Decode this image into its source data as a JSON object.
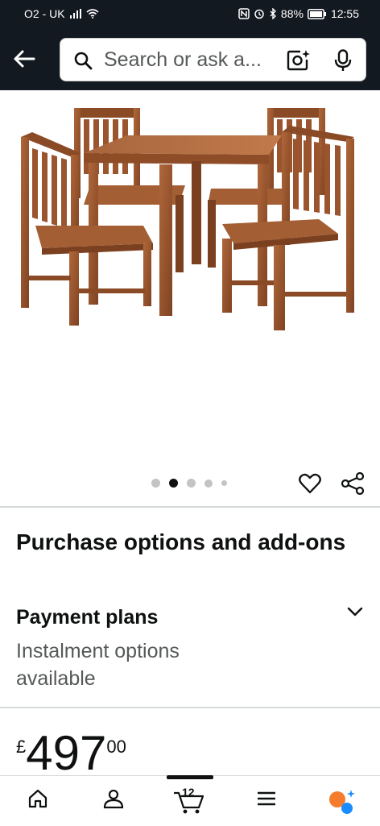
{
  "status_bar": {
    "carrier": "O2 - UK",
    "battery": "88%",
    "time": "12:55"
  },
  "search": {
    "placeholder": "Search or ask a..."
  },
  "carousel": {
    "total_dots": 5,
    "active_index": 1
  },
  "purchase": {
    "section_title": "Purchase options and add-ons",
    "payment_title": "Payment plans",
    "payment_subtitle": "Instalment options available"
  },
  "price": {
    "symbol": "£",
    "whole": "497",
    "fraction": "00"
  },
  "bottom_nav": {
    "cart_count": "12"
  },
  "colors": {
    "header_bg": "#131921",
    "assistant_orange": "#f47c2c",
    "assistant_blue": "#1a8cff"
  }
}
